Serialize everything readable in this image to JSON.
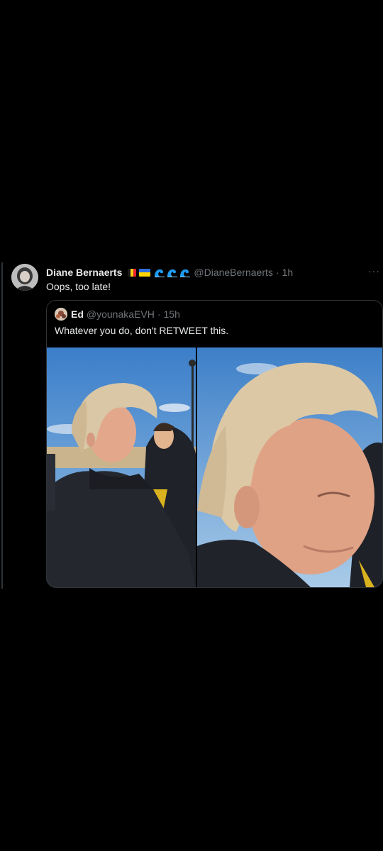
{
  "tweet": {
    "author_name": "Diane Bernaerts",
    "handle": "@DianeBernaerts",
    "separator": "·",
    "time": "1h",
    "text": "Oops, too late!",
    "more_label": "···",
    "badges": [
      "belgium-flag",
      "ukraine-flag",
      "wave",
      "wave",
      "wave"
    ]
  },
  "quote": {
    "author_name": "Ed",
    "handle": "@younakaEVH",
    "separator": "·",
    "time": "15h",
    "text": "Whatever you do, don't RETWEET this.",
    "media_count": 2
  },
  "colors": {
    "background": "#000000",
    "text_primary": "#e7e9ea",
    "text_secondary": "#71767b",
    "border": "#2f3336",
    "wave_blue": "#1d9bf0"
  }
}
